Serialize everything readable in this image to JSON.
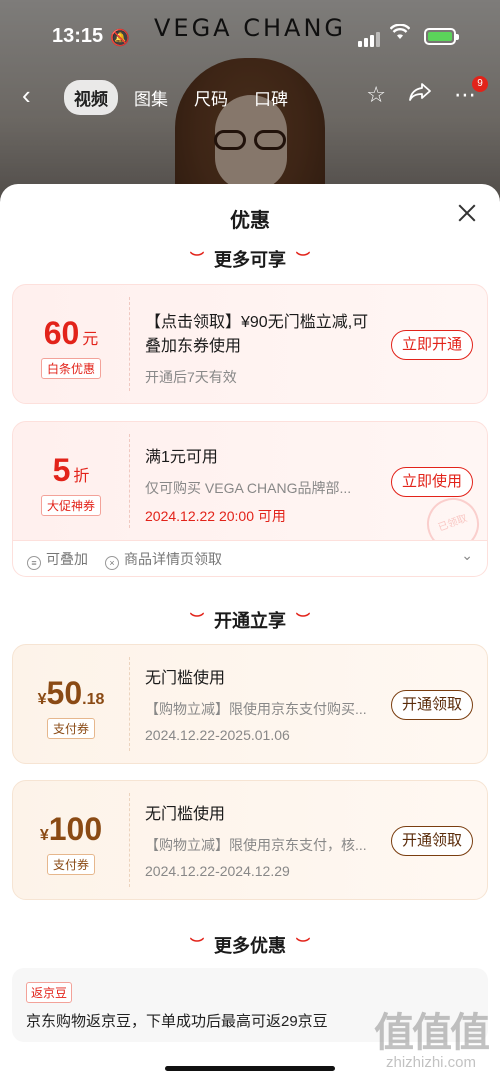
{
  "status": {
    "time": "13:15"
  },
  "background": {
    "brand": "VEGA CHANG"
  },
  "navbar": {
    "tabs": [
      "视频",
      "图集",
      "尺码",
      "口碑"
    ],
    "badge": "9"
  },
  "sheet": {
    "title": "优惠",
    "sections": [
      "更多可享",
      "开通立享",
      "更多优惠"
    ]
  },
  "coupons": [
    {
      "amount": "60",
      "unit": "元",
      "tag": "白条优惠",
      "desc": "【点击领取】¥90无门槛立减,可叠加东券使用",
      "sub": "开通后7天有效",
      "button": "立即开通"
    },
    {
      "amount": "5",
      "unit": "折",
      "tag": "大促神券",
      "desc": "满1元可用",
      "sub": "仅可购买 VEGA CHANG品牌部...",
      "date": "2024.12.22 20:00 可用",
      "button": "立即使用",
      "stamp": "已领取",
      "footer": {
        "stack": "可叠加",
        "source": "商品详情页领取"
      }
    },
    {
      "symbol": "¥",
      "amount": "50",
      "decimal": ".18",
      "tag": "支付券",
      "desc": "无门槛使用",
      "sub": "【购物立减】限使用京东支付购买...",
      "date": "2024.12.22-2025.01.06",
      "button": "开通领取"
    },
    {
      "symbol": "¥",
      "amount": "100",
      "tag": "支付券",
      "desc": "无门槛使用",
      "sub": "【购物立减】限使用京东支付，核...",
      "date": "2024.12.22-2024.12.29",
      "button": "开通领取"
    }
  ],
  "more": {
    "tag": "返京豆",
    "text": "京东购物返京豆，下单成功后最高可返29京豆"
  },
  "watermark": {
    "glyphs": "值值值",
    "url": "zhizhizhi.com"
  }
}
